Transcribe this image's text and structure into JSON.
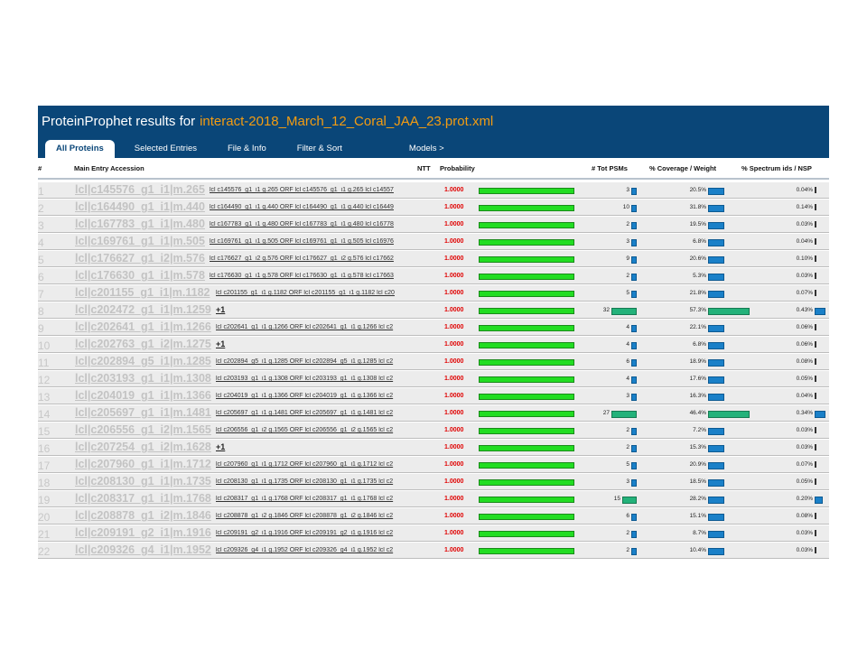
{
  "title": {
    "prefix": "ProteinProphet results for",
    "filename": "interact-2018_March_12_Coral_JAA_23.prot.xml"
  },
  "tabs": [
    {
      "label": "All Proteins",
      "active": true
    },
    {
      "label": "Selected Entries",
      "active": false
    },
    {
      "label": "File & Info",
      "active": false
    },
    {
      "label": "Filter & Sort",
      "active": false
    },
    {
      "label": "Models >",
      "active": false
    }
  ],
  "columns": {
    "num": "#",
    "accession": "Main Entry Accession",
    "ntt": "NTT",
    "probability": "Probability",
    "psms": "# Tot PSMs",
    "coverage": "% Coverage / Weight",
    "spectrum": "% Spectrum ids / NSP"
  },
  "colors": {
    "header_bg": "#0a4678",
    "filename": "#f39c12",
    "probability_text": "#e00000",
    "probability_bar": "#22dd22",
    "bar_blue": "#1a80c8",
    "bar_teal": "#23b27a"
  },
  "rows": [
    {
      "num": "1",
      "accession": "lcl|c145576_g1_i1|m.265",
      "desc": "lcl c145576_g1_i1 g.265 ORF lcl c145576_g1_i1 g.265 lcl c14557",
      "plus": "",
      "prob": "1.0000",
      "psms": "3",
      "coverage": "20.5%",
      "spectrum": "0.04%"
    },
    {
      "num": "2",
      "accession": "lcl|c164490_g1_i1|m.440",
      "desc": "lcl c164490_g1_i1 g.440 ORF lcl c164490_g1_i1 g.440 lcl c16449",
      "plus": "",
      "prob": "1.0000",
      "psms": "10",
      "coverage": "31.8%",
      "spectrum": "0.14%"
    },
    {
      "num": "3",
      "accession": "lcl|c167783_g1_i1|m.480",
      "desc": "lcl c167783_g1_i1 g.480 ORF lcl c167783_g1_i1 g.480 lcl c16778",
      "plus": "",
      "prob": "1.0000",
      "psms": "2",
      "coverage": "19.5%",
      "spectrum": "0.03%"
    },
    {
      "num": "4",
      "accession": "lcl|c169761_g1_i1|m.505",
      "desc": "lcl c169761_g1_i1 g.505 ORF lcl c169761_g1_i1 g.505 lcl c16976",
      "plus": "",
      "prob": "1.0000",
      "psms": "3",
      "coverage": "6.8%",
      "spectrum": "0.04%"
    },
    {
      "num": "5",
      "accession": "lcl|c176627_g1_i2|m.576",
      "desc": "lcl c176627_g1_i2 g.576 ORF lcl c176627_g1_i2 g.576 lcl c17662",
      "plus": "",
      "prob": "1.0000",
      "psms": "9",
      "coverage": "20.6%",
      "spectrum": "0.10%"
    },
    {
      "num": "6",
      "accession": "lcl|c176630_g1_i1|m.578",
      "desc": "lcl c176630_g1_i1 g.578 ORF lcl c176630_g1_i1 g.578 lcl c17663",
      "plus": "",
      "prob": "1.0000",
      "psms": "2",
      "coverage": "5.3%",
      "spectrum": "0.03%"
    },
    {
      "num": "7",
      "accession": "lcl|c201155_g1_i1|m.1182",
      "desc": "lcl c201155_g1_i1 g.1182 ORF lcl c201155_g1_i1 g.1182 lcl c20",
      "plus": "",
      "prob": "1.0000",
      "psms": "5",
      "coverage": "21.8%",
      "spectrum": "0.07%"
    },
    {
      "num": "8",
      "accession": "lcl|c202472_g1_i1|m.1259",
      "desc": "",
      "plus": "+1",
      "prob": "1.0000",
      "psms": "32",
      "coverage": "57.3%",
      "spectrum": "0.43%"
    },
    {
      "num": "9",
      "accession": "lcl|c202641_g1_i1|m.1266",
      "desc": "lcl c202641_g1_i1 g.1266 ORF lcl c202641_g1_i1 g.1266 lcl c2",
      "plus": "",
      "prob": "1.0000",
      "psms": "4",
      "coverage": "22.1%",
      "spectrum": "0.06%"
    },
    {
      "num": "10",
      "accession": "lcl|c202763_g1_i2|m.1275",
      "desc": "",
      "plus": "+1",
      "prob": "1.0000",
      "psms": "4",
      "coverage": "6.8%",
      "spectrum": "0.06%"
    },
    {
      "num": "11",
      "accession": "lcl|c202894_g5_i1|m.1285",
      "desc": "lcl c202894_g5_i1 g.1285 ORF lcl c202894_g5_i1 g.1285 lcl c2",
      "plus": "",
      "prob": "1.0000",
      "psms": "6",
      "coverage": "18.9%",
      "spectrum": "0.08%"
    },
    {
      "num": "12",
      "accession": "lcl|c203193_g1_i1|m.1308",
      "desc": "lcl c203193_g1_i1 g.1308 ORF lcl c203193_g1_i1 g.1308 lcl c2",
      "plus": "",
      "prob": "1.0000",
      "psms": "4",
      "coverage": "17.6%",
      "spectrum": "0.05%"
    },
    {
      "num": "13",
      "accession": "lcl|c204019_g1_i1|m.1366",
      "desc": "lcl c204019_g1_i1 g.1366 ORF lcl c204019_g1_i1 g.1366 lcl c2",
      "plus": "",
      "prob": "1.0000",
      "psms": "3",
      "coverage": "16.3%",
      "spectrum": "0.04%"
    },
    {
      "num": "14",
      "accession": "lcl|c205697_g1_i1|m.1481",
      "desc": "lcl c205697_g1_i1 g.1481 ORF lcl c205697_g1_i1 g.1481 lcl c2",
      "plus": "",
      "prob": "1.0000",
      "psms": "27",
      "coverage": "46.4%",
      "spectrum": "0.34%"
    },
    {
      "num": "15",
      "accession": "lcl|c206556_g1_i2|m.1565",
      "desc": "lcl c206556_g1_i2 g.1565 ORF lcl c206556_g1_i2 g.1565 lcl c2",
      "plus": "",
      "prob": "1.0000",
      "psms": "2",
      "coverage": "7.2%",
      "spectrum": "0.03%"
    },
    {
      "num": "16",
      "accession": "lcl|c207254_g1_i2|m.1628",
      "desc": "",
      "plus": "+1",
      "prob": "1.0000",
      "psms": "2",
      "coverage": "15.3%",
      "spectrum": "0.03%"
    },
    {
      "num": "17",
      "accession": "lcl|c207960_g1_i1|m.1712",
      "desc": "lcl c207960_g1_i1 g.1712 ORF lcl c207960_g1_i1 g.1712 lcl c2",
      "plus": "",
      "prob": "1.0000",
      "psms": "5",
      "coverage": "20.9%",
      "spectrum": "0.07%"
    },
    {
      "num": "18",
      "accession": "lcl|c208130_g1_i1|m.1735",
      "desc": "lcl c208130_g1_i1 g.1735 ORF lcl c208130_g1_i1 g.1735 lcl c2",
      "plus": "",
      "prob": "1.0000",
      "psms": "3",
      "coverage": "18.5%",
      "spectrum": "0.05%"
    },
    {
      "num": "19",
      "accession": "lcl|c208317_g1_i1|m.1768",
      "desc": "lcl c208317_g1_i1 g.1768 ORF lcl c208317_g1_i1 g.1768 lcl c2",
      "plus": "",
      "prob": "1.0000",
      "psms": "15",
      "coverage": "28.2%",
      "spectrum": "0.20%"
    },
    {
      "num": "20",
      "accession": "lcl|c208878_g1_i2|m.1846",
      "desc": "lcl c208878_g1_i2 g.1846 ORF lcl c208878_g1_i2 g.1846 lcl c2",
      "plus": "",
      "prob": "1.0000",
      "psms": "6",
      "coverage": "15.1%",
      "spectrum": "0.08%"
    },
    {
      "num": "21",
      "accession": "lcl|c209191_g2_i1|m.1916",
      "desc": "lcl c209191_g2_i1 g.1916 ORF lcl c209191_g2_i1 g.1916 lcl c2",
      "plus": "",
      "prob": "1.0000",
      "psms": "2",
      "coverage": "8.7%",
      "spectrum": "0.03%"
    },
    {
      "num": "22",
      "accession": "lcl|c209326_g4_i1|m.1952",
      "desc": "lcl c209326_g4_i1 g.1952 ORF lcl c209326_g4_i1 g.1952 lcl c2",
      "plus": "",
      "prob": "1.0000",
      "psms": "2",
      "coverage": "10.4%",
      "spectrum": "0.03%"
    }
  ]
}
